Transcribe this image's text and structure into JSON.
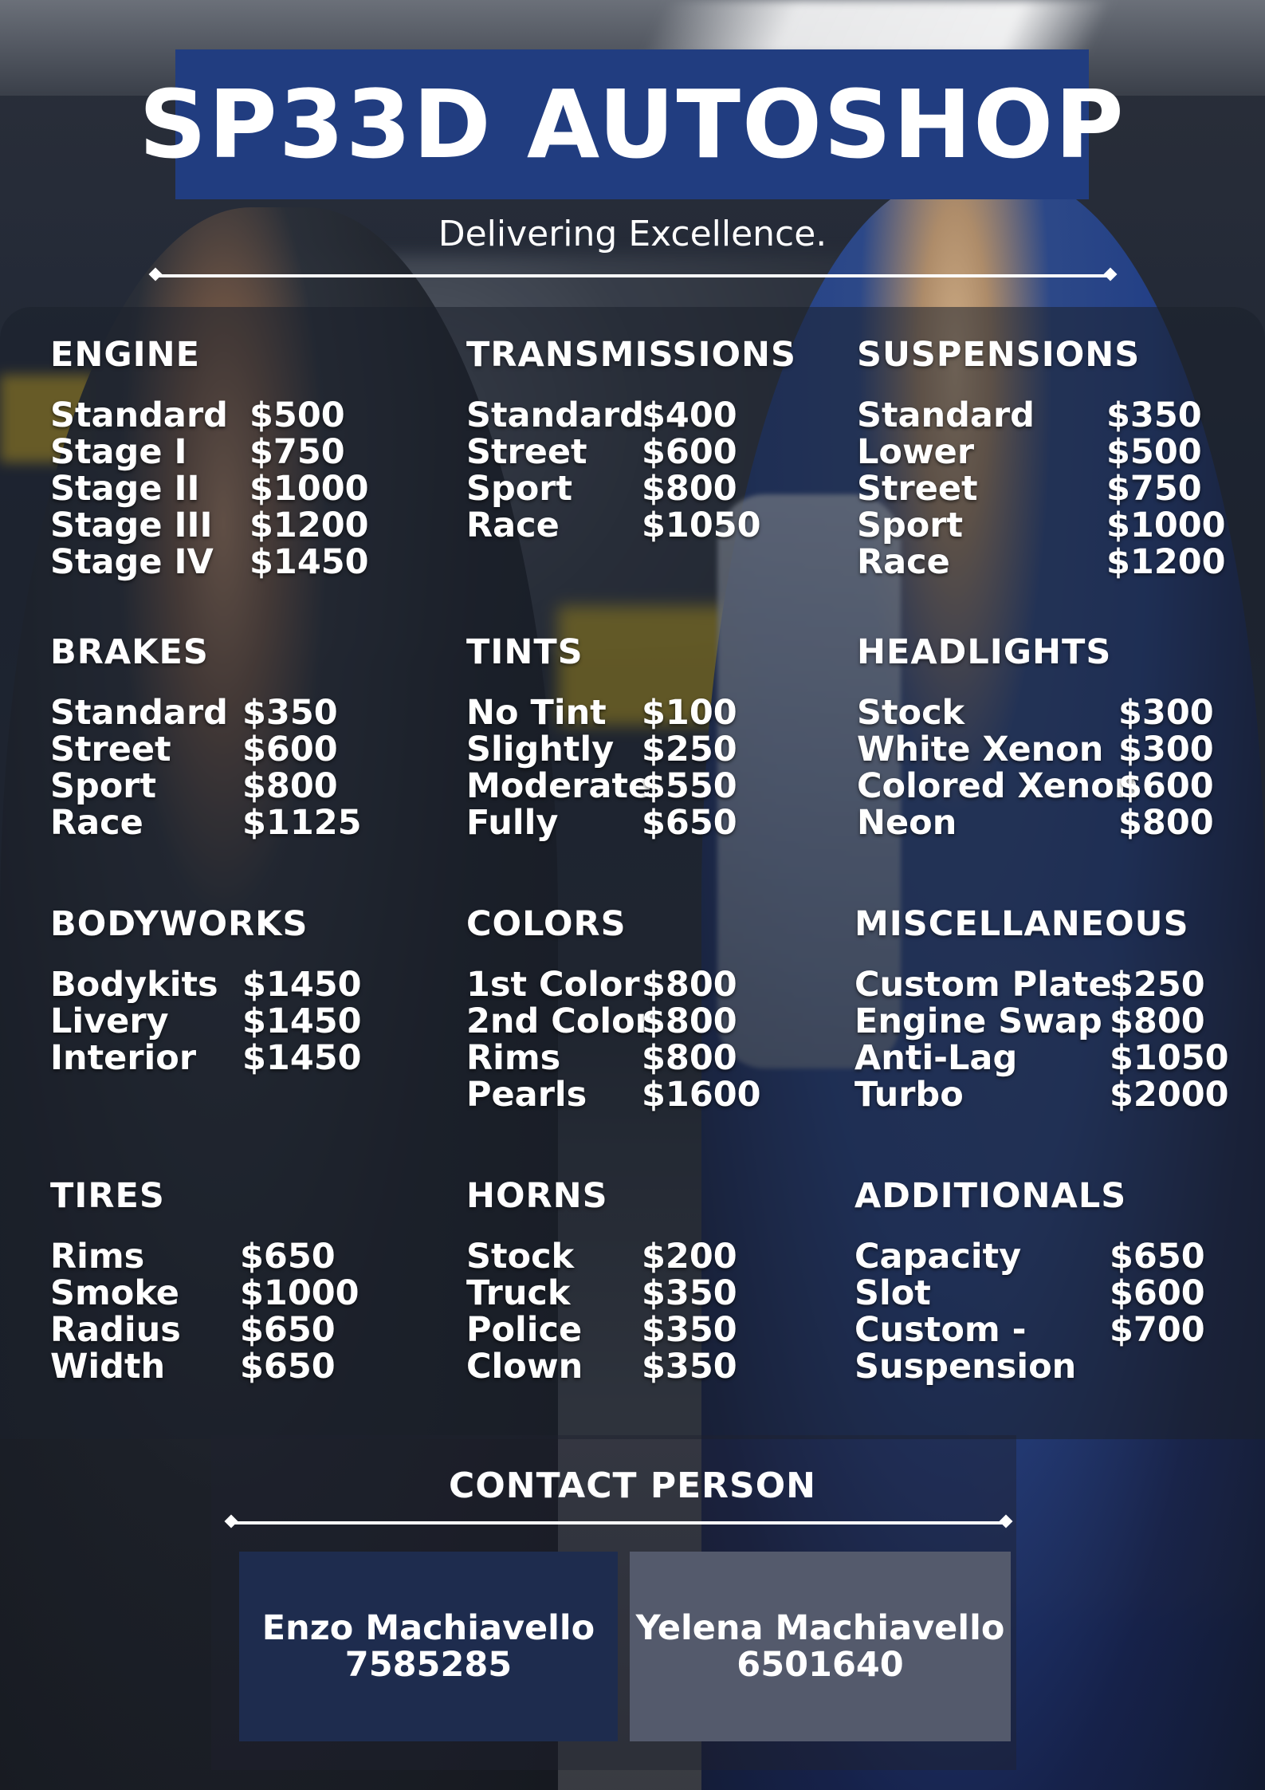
{
  "header": {
    "title": "SP33D AUTOSHOP",
    "tagline": "Delivering Excellence."
  },
  "colors": {
    "title_bg": "#213d80",
    "card_dark": "#1e2c4e",
    "card_gray": "#545a6c",
    "text": "#ffffff"
  },
  "sections": {
    "engine": {
      "title": "ENGINE",
      "items": [
        {
          "name": "Standard",
          "price": "$500"
        },
        {
          "name": "Stage I",
          "price": "$750"
        },
        {
          "name": "Stage II",
          "price": "$1000"
        },
        {
          "name": "Stage III",
          "price": "$1200"
        },
        {
          "name": "Stage IV",
          "price": "$1450"
        }
      ]
    },
    "transmissions": {
      "title": "TRANSMISSIONS",
      "items": [
        {
          "name": "Standard",
          "price": "$400"
        },
        {
          "name": "Street",
          "price": "$600"
        },
        {
          "name": "Sport",
          "price": "$800"
        },
        {
          "name": "Race",
          "price": "$1050"
        }
      ]
    },
    "suspensions": {
      "title": "SUSPENSIONS",
      "items": [
        {
          "name": "Standard",
          "price": "$350"
        },
        {
          "name": "Lower",
          "price": "$500"
        },
        {
          "name": "Street",
          "price": "$750"
        },
        {
          "name": "Sport",
          "price": "$1000"
        },
        {
          "name": "Race",
          "price": "$1200"
        }
      ]
    },
    "brakes": {
      "title": "BRAKES",
      "items": [
        {
          "name": "Standard",
          "price": "$350"
        },
        {
          "name": "Street",
          "price": "$600"
        },
        {
          "name": "Sport",
          "price": "$800"
        },
        {
          "name": "Race",
          "price": "$1125"
        }
      ]
    },
    "tints": {
      "title": "TINTS",
      "items": [
        {
          "name": "No Tint",
          "price": "$100"
        },
        {
          "name": "Slightly",
          "price": "$250"
        },
        {
          "name": "Moderate",
          "price": "$550"
        },
        {
          "name": "Fully",
          "price": "$650"
        }
      ]
    },
    "headlights": {
      "title": "HEADLIGHTS",
      "items": [
        {
          "name": "Stock",
          "price": "$300"
        },
        {
          "name": "White Xenon",
          "price": "$300"
        },
        {
          "name": "Colored Xenon",
          "price": "$600"
        },
        {
          "name": "Neon",
          "price": "$800"
        }
      ]
    },
    "bodyworks": {
      "title": "BODYWORKS",
      "items": [
        {
          "name": "Bodykits",
          "price": "$1450"
        },
        {
          "name": "Livery",
          "price": "$1450"
        },
        {
          "name": "Interior",
          "price": "$1450"
        }
      ]
    },
    "colors_menu": {
      "title": "COLORS",
      "items": [
        {
          "name": "1st Color",
          "price": "$800"
        },
        {
          "name": "2nd Color",
          "price": "$800"
        },
        {
          "name": "Rims",
          "price": "$800"
        },
        {
          "name": "Pearls",
          "price": "$1600"
        }
      ]
    },
    "miscellaneous": {
      "title": "MISCELLANEOUS",
      "items": [
        {
          "name": "Custom Plate",
          "price": "$250"
        },
        {
          "name": "Engine Swap",
          "price": "$800"
        },
        {
          "name": "Anti-Lag",
          "price": "$1050"
        },
        {
          "name": "Turbo",
          "price": "$2000"
        }
      ]
    },
    "tires": {
      "title": "TIRES",
      "items": [
        {
          "name": "Rims",
          "price": "$650"
        },
        {
          "name": "Smoke",
          "price": "$1000"
        },
        {
          "name": "Radius",
          "price": "$650"
        },
        {
          "name": "Width",
          "price": "$650"
        }
      ]
    },
    "horns": {
      "title": "HORNS",
      "items": [
        {
          "name": "Stock",
          "price": "$200"
        },
        {
          "name": "Truck",
          "price": "$350"
        },
        {
          "name": "Police",
          "price": "$350"
        },
        {
          "name": "Clown",
          "price": "$350"
        }
      ]
    },
    "additionals": {
      "title": "ADDITIONALS",
      "items": [
        {
          "name": "Capacity",
          "price": "$650"
        },
        {
          "name": "Slot",
          "price": "$600"
        },
        {
          "name": "Custom -",
          "price": "$700"
        },
        {
          "name": "Suspension",
          "price": ""
        }
      ]
    }
  },
  "contact": {
    "title": "CONTACT PERSON",
    "people": [
      {
        "name": "Enzo Machiavello",
        "phone": "7585285"
      },
      {
        "name": "Yelena Machiavello",
        "phone": "6501640"
      }
    ]
  }
}
